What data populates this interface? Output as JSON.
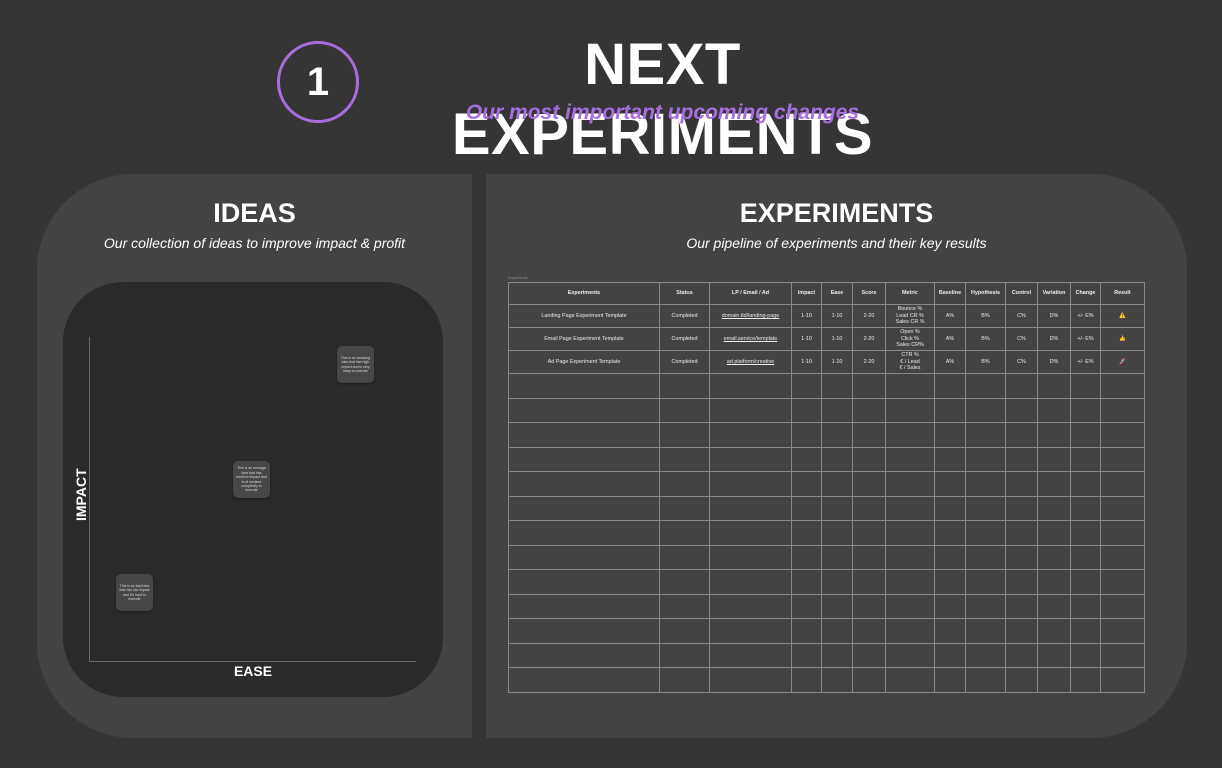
{
  "header": {
    "step_number": "1",
    "title": "NEXT EXPERIMENTS",
    "subtitle": "Our most important upcoming changes",
    "accent_color": "#a86ee0"
  },
  "ideas": {
    "title": "IDEAS",
    "subtitle": "Our collection of ideas to improve impact & profit",
    "y_axis_label": "IMPACT",
    "x_axis_label": "EASE",
    "notes": [
      "This is an amazing idea that has high impact and is very easy to execute",
      "This is an average idea that has medium impact and is of medium complexity to execute",
      "This is an bad idea that has low impact and it's hard to execute"
    ]
  },
  "experiments": {
    "title": "EXPERIMENTS",
    "subtitle": "Our pipeline of experiments and their key results",
    "table_caption": "Experiments",
    "columns": [
      "Experiments",
      "Status",
      "LP / Email / Ad",
      "Impact",
      "Ease",
      "Score",
      "Metric",
      "Baseline",
      "Hypothesis",
      "Control",
      "Variation",
      "Change",
      "Result"
    ],
    "rows": [
      {
        "experiment": "Landing Page Experiment Template",
        "status": "Completed",
        "link": "domain.tld/landing-page",
        "impact": "1-10",
        "ease": "1-10",
        "score": "2-20",
        "metric": [
          "Bounce %",
          "Lead CR %",
          "Sales CR %"
        ],
        "baseline": "A%",
        "hypothesis": "B%",
        "control": "C%",
        "variation": "D%",
        "change": "+/- E%",
        "result": "⚠️"
      },
      {
        "experiment": "Email Page Experiment Template",
        "status": "Completed",
        "link": "email.service/template",
        "impact": "1-10",
        "ease": "1-10",
        "score": "2-20",
        "metric": [
          "Open %",
          "Click %",
          "Sales CR%"
        ],
        "baseline": "A%",
        "hypothesis": "B%",
        "control": "C%",
        "variation": "D%",
        "change": "+/- E%",
        "result": "👍"
      },
      {
        "experiment": "Ad Page Experiment Template",
        "status": "Completed",
        "link": "ad.platform/creative",
        "impact": "1-10",
        "ease": "1-10",
        "score": "2-20",
        "metric": [
          "CTR %",
          "€ / Lead",
          "€ / Sales"
        ],
        "baseline": "A%",
        "hypothesis": "B%",
        "control": "C%",
        "variation": "D%",
        "change": "+/- E%",
        "result": "🚀"
      }
    ],
    "empty_rows": 13
  }
}
